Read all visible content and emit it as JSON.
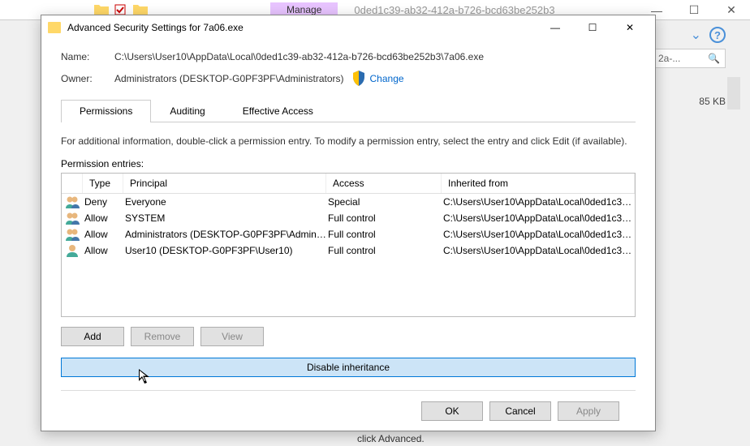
{
  "background": {
    "manage_label": "Manage",
    "title": "0ded1c39-ab32-412a-b726-bcd63be252b3",
    "search_placeholder": "2a-...",
    "file_size": "85 KB",
    "advanced_text": "click Advanced."
  },
  "dialog": {
    "title": "Advanced Security Settings for 7a06.exe",
    "name_label": "Name:",
    "name_value": "C:\\Users\\User10\\AppData\\Local\\0ded1c39-ab32-412a-b726-bcd63be252b3\\7a06.exe",
    "owner_label": "Owner:",
    "owner_value": "Administrators (DESKTOP-G0PF3PF\\Administrators)",
    "change_link": "Change",
    "tabs": {
      "permissions": "Permissions",
      "auditing": "Auditing",
      "effective_access": "Effective Access"
    },
    "help_text": "For additional information, double-click a permission entry. To modify a permission entry, select the entry and click Edit (if available).",
    "entries_label": "Permission entries:",
    "columns": {
      "type": "Type",
      "principal": "Principal",
      "access": "Access",
      "inherited": "Inherited from"
    },
    "rows": [
      {
        "type": "Deny",
        "principal": "Everyone",
        "access": "Special",
        "inherited": "C:\\Users\\User10\\AppData\\Local\\0ded1c39-..."
      },
      {
        "type": "Allow",
        "principal": "SYSTEM",
        "access": "Full control",
        "inherited": "C:\\Users\\User10\\AppData\\Local\\0ded1c39-..."
      },
      {
        "type": "Allow",
        "principal": "Administrators (DESKTOP-G0PF3PF\\Admini...",
        "access": "Full control",
        "inherited": "C:\\Users\\User10\\AppData\\Local\\0ded1c39-..."
      },
      {
        "type": "Allow",
        "principal": "User10 (DESKTOP-G0PF3PF\\User10)",
        "access": "Full control",
        "inherited": "C:\\Users\\User10\\AppData\\Local\\0ded1c39-..."
      }
    ],
    "buttons": {
      "add": "Add",
      "remove": "Remove",
      "view": "View",
      "disable_inheritance": "Disable inheritance",
      "ok": "OK",
      "cancel": "Cancel",
      "apply": "Apply"
    }
  }
}
